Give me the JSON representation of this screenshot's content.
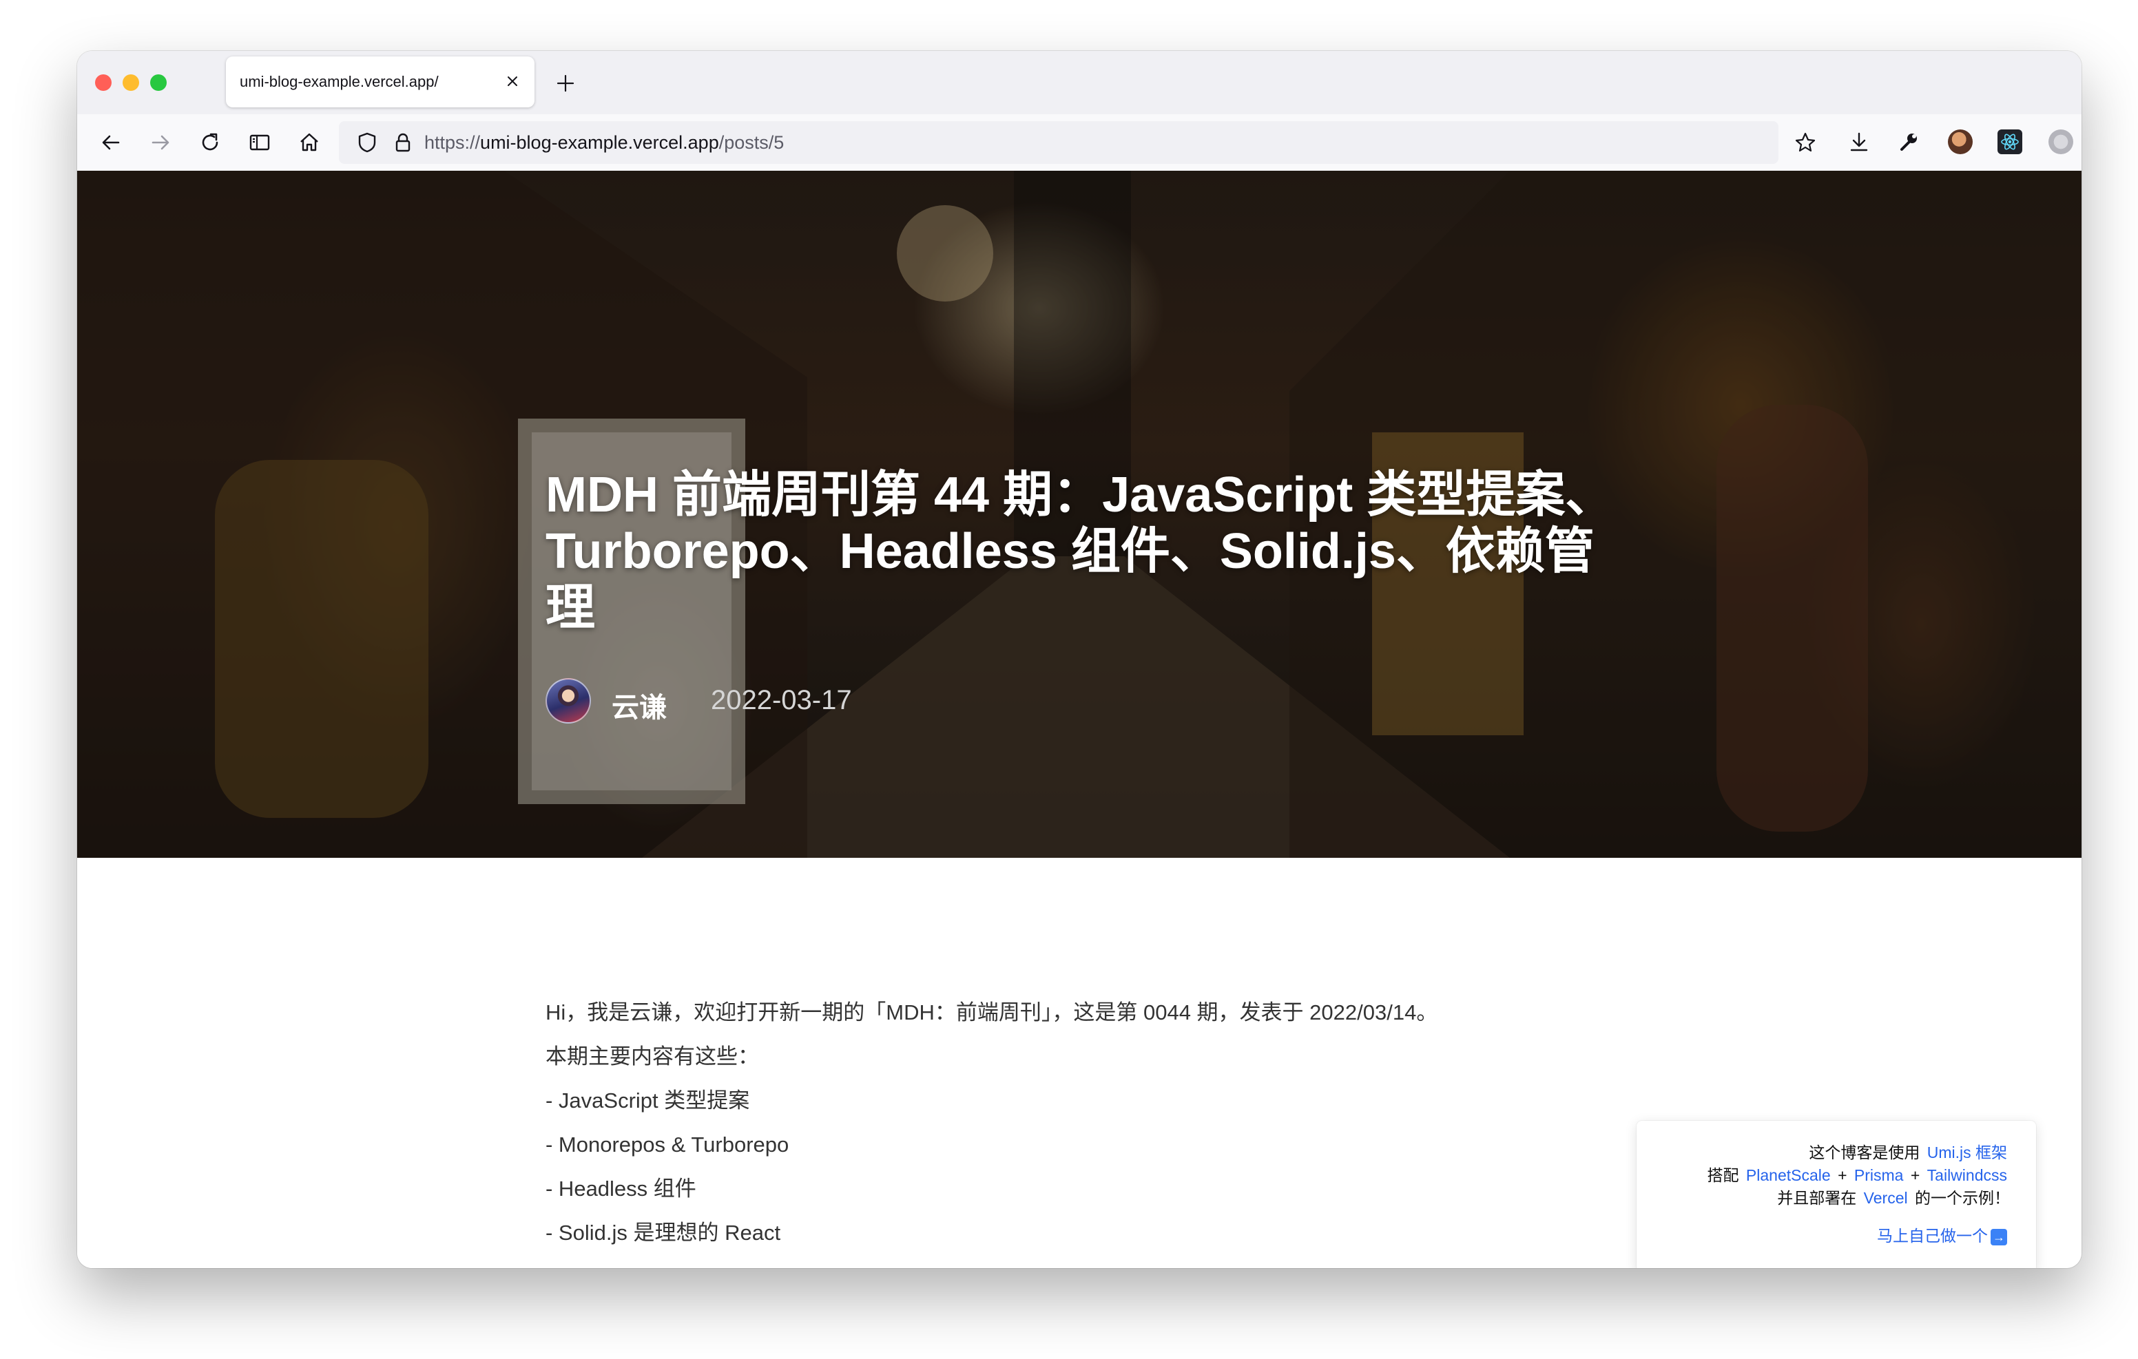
{
  "browser": {
    "tab": {
      "title": "umi-blog-example.vercel.app/"
    },
    "url": {
      "scheme": "https://",
      "host": "umi-blog-example.vercel.app",
      "path": "/posts/5"
    },
    "icons": {
      "back": "back-arrow-icon",
      "forward": "forward-arrow-icon",
      "reload": "reload-icon",
      "sidebar": "sidebar-icon",
      "home": "home-icon",
      "shield": "tracking-shield-icon",
      "lock": "lock-icon",
      "bookmark": "star-icon",
      "downloads": "download-icon",
      "tools": "wrench-icon",
      "menu": "hamburger-menu-icon"
    }
  },
  "post": {
    "title": "MDH 前端周刊第 44 期：JavaScript 类型提案、Turborepo、Headless 组件、Solid.js、依赖管理",
    "author": "云谦",
    "date": "2022-03-17",
    "paragraphs": [
      "Hi，我是云谦，欢迎打开新一期的「MDH：前端周刊」，这是第 0044 期，发表于 2022/03/14。",
      "本期主要内容有这些：",
      "- JavaScript 类型提案",
      "- Monorepos & Turborepo",
      "- Headless 组件",
      "- Solid.js 是理想的 React"
    ]
  },
  "promo": {
    "line1_text": "这个博客是使用",
    "line1_link": "Umi.js 框架",
    "line2_prefix": "搭配",
    "link_planetscale": "PlanetScale",
    "plus1": "+",
    "link_prisma": "Prisma",
    "plus2": "+",
    "link_tailwind": "Tailwindcss",
    "line3_prefix": "并且部署在",
    "link_vercel": "Vercel",
    "line3_suffix": "的一个示例！",
    "cta": "马上自己做一个",
    "cta_icon": "arrow-right-box-icon"
  },
  "colors": {
    "link": "#2563eb",
    "close_red": "#ff5f57",
    "minimize_yellow": "#febc2e",
    "zoom_green": "#28c840"
  }
}
